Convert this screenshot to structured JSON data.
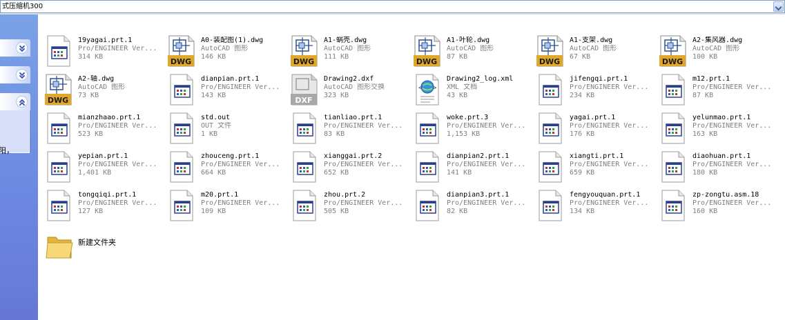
{
  "address_bar": {
    "path": "式压缩机300"
  },
  "task_pane": {
    "fragment": "阳，"
  },
  "files": [
    {
      "name": "19yagai.prt.1",
      "type": "Pro/ENGINEER Ver...",
      "size": "314 KB",
      "icon": "proe-icon"
    },
    {
      "name": "A0-装配图(1).dwg",
      "type": "AutoCAD 图形",
      "size": "146 KB",
      "icon": "dwg-icon"
    },
    {
      "name": "A1-蜗壳.dwg",
      "type": "AutoCAD 图形",
      "size": "111 KB",
      "icon": "dwg-icon"
    },
    {
      "name": "A1-叶轮.dwg",
      "type": "AutoCAD 图形",
      "size": "87 KB",
      "icon": "dwg-icon"
    },
    {
      "name": "A1-支架.dwg",
      "type": "AutoCAD 图形",
      "size": "67 KB",
      "icon": "dwg-icon"
    },
    {
      "name": "A2-集风器.dwg",
      "type": "AutoCAD 图形",
      "size": "100 KB",
      "icon": "dwg-icon"
    },
    {
      "name": "A2-轴.dwg",
      "type": "AutoCAD 图形",
      "size": "73 KB",
      "icon": "dwg-icon"
    },
    {
      "name": "dianpian.prt.1",
      "type": "Pro/ENGINEER Ver...",
      "size": "143 KB",
      "icon": "proe-icon"
    },
    {
      "name": "Drawing2.dxf",
      "type": "AutoCAD 图形交换",
      "size": "323 KB",
      "icon": "dxf-icon"
    },
    {
      "name": "Drawing2_log.xml",
      "type": "XML 文档",
      "size": "43 KB",
      "icon": "xml-icon"
    },
    {
      "name": "jifengqi.prt.1",
      "type": "Pro/ENGINEER Ver...",
      "size": "234 KB",
      "icon": "proe-icon"
    },
    {
      "name": "m12.prt.1",
      "type": "Pro/ENGINEER Ver...",
      "size": "87 KB",
      "icon": "proe-icon"
    },
    {
      "name": "mianzhaao.prt.1",
      "type": "Pro/ENGINEER Ver...",
      "size": "523 KB",
      "icon": "proe-icon"
    },
    {
      "name": "std.out",
      "type": "OUT 文件",
      "size": "1 KB",
      "icon": "proe-icon"
    },
    {
      "name": "tianliao.prt.1",
      "type": "Pro/ENGINEER Ver...",
      "size": "83 KB",
      "icon": "proe-icon"
    },
    {
      "name": "woke.prt.3",
      "type": "Pro/ENGINEER Ver...",
      "size": "1,153 KB",
      "icon": "proe-icon"
    },
    {
      "name": "yagai.prt.1",
      "type": "Pro/ENGINEER Ver...",
      "size": "176 KB",
      "icon": "proe-icon"
    },
    {
      "name": "yelunmao.prt.1",
      "type": "Pro/ENGINEER Ver...",
      "size": "163 KB",
      "icon": "proe-icon"
    },
    {
      "name": "yepian.prt.1",
      "type": "Pro/ENGINEER Ver...",
      "size": "1,401 KB",
      "icon": "proe-icon"
    },
    {
      "name": "zhouceng.prt.1",
      "type": "Pro/ENGINEER Ver...",
      "size": "664 KB",
      "icon": "proe-icon"
    },
    {
      "name": "xianggai.prt.2",
      "type": "Pro/ENGINEER Ver...",
      "size": "652 KB",
      "icon": "proe-icon"
    },
    {
      "name": "dianpian2.prt.1",
      "type": "Pro/ENGINEER Ver...",
      "size": "141 KB",
      "icon": "proe-icon"
    },
    {
      "name": "xiangti.prt.1",
      "type": "Pro/ENGINEER Ver...",
      "size": "659 KB",
      "icon": "proe-icon"
    },
    {
      "name": "diaohuan.prt.1",
      "type": "Pro/ENGINEER Ver...",
      "size": "180 KB",
      "icon": "proe-icon"
    },
    {
      "name": "tongqiqi.prt.1",
      "type": "Pro/ENGINEER Ver...",
      "size": "127 KB",
      "icon": "proe-icon"
    },
    {
      "name": "m20.prt.1",
      "type": "Pro/ENGINEER Ver...",
      "size": "109 KB",
      "icon": "proe-icon"
    },
    {
      "name": "zhou.prt.2",
      "type": "Pro/ENGINEER Ver...",
      "size": "505 KB",
      "icon": "proe-icon"
    },
    {
      "name": "dianpian3.prt.1",
      "type": "Pro/ENGINEER Ver...",
      "size": "82 KB",
      "icon": "proe-icon"
    },
    {
      "name": "fengyouquan.prt.1",
      "type": "Pro/ENGINEER Ver...",
      "size": "134 KB",
      "icon": "proe-icon"
    },
    {
      "name": "zp-zongtu.asm.18",
      "type": "Pro/ENGINEER Ver...",
      "size": "160 KB",
      "icon": "proe-icon"
    }
  ],
  "folder": {
    "name": "新建文件夹",
    "icon": "folder-icon"
  }
}
